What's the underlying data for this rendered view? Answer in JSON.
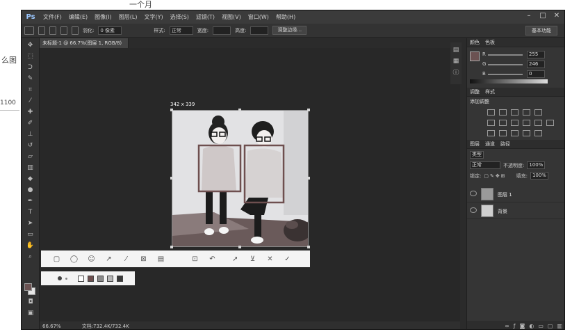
{
  "background": {
    "heading_fragment": "一个月",
    "side_text": "么图",
    "side_number": "1100"
  },
  "menubar": {
    "logo": "Ps",
    "items": [
      "文件(F)",
      "编辑(E)",
      "图像(I)",
      "图层(L)",
      "文字(Y)",
      "选择(S)",
      "滤镜(T)",
      "视图(V)",
      "窗口(W)",
      "帮助(H)"
    ],
    "controls": [
      "–",
      "□",
      "✕"
    ]
  },
  "options": {
    "feather_label": "羽化:",
    "feather_value": "0 像素",
    "style_label": "样式:",
    "style_value": "正常",
    "width_label": "宽度:",
    "height_label": "高度:",
    "refine_edge": "调整边缘...",
    "workspace": "基本功能"
  },
  "document": {
    "tab": "未标题-1 @ 66.7%(图层 1, RGB/8)",
    "zoom": "66.67%",
    "doc_info": "文档:732.4K/732.4K"
  },
  "capture": {
    "size_label": "342 x 339"
  },
  "snip_tools": {
    "buttons": [
      {
        "name": "rectangle-tool-icon",
        "glyph": "▢"
      },
      {
        "name": "ellipse-tool-icon",
        "glyph": "◯"
      },
      {
        "name": "emoji-tool-icon",
        "glyph": "☺"
      },
      {
        "name": "arrow-tool-icon",
        "glyph": "↗"
      },
      {
        "name": "pen-tool-icon",
        "glyph": "⁄"
      },
      {
        "name": "mosaic-tool-icon",
        "glyph": "⊠"
      },
      {
        "name": "text-tool-icon",
        "glyph": "▤"
      },
      {
        "name": "pin-tool-icon",
        "glyph": "⊡"
      },
      {
        "name": "undo-icon",
        "glyph": "↶"
      },
      {
        "name": "share-icon",
        "glyph": "➚"
      },
      {
        "name": "save-icon",
        "glyph": "⊻"
      },
      {
        "name": "close-icon",
        "glyph": "✕"
      },
      {
        "name": "confirm-icon",
        "glyph": "✓"
      }
    ],
    "palette": [
      "#ffffff",
      "#6e4f4f",
      "#8a8a8a",
      "#b8b8b8",
      "#3a3a3a"
    ]
  },
  "panels": {
    "color_tabs": [
      "颜色",
      "色板"
    ],
    "color_sliders": [
      {
        "label": "R",
        "value": "255"
      },
      {
        "label": "G",
        "value": "246"
      },
      {
        "label": "B",
        "value": "0"
      }
    ],
    "adjust_tabs": [
      "调整",
      "样式"
    ],
    "adjust_title": "添加调整",
    "layer_tabs": [
      "图层",
      "通道",
      "路径"
    ],
    "kind_label": "类型",
    "blend_mode": "正常",
    "opacity_label": "不透明度:",
    "opacity_value": "100%",
    "lock_label": "锁定:",
    "fill_label": "填充:",
    "fill_value": "100%",
    "layers": [
      {
        "name": "图层 1"
      },
      {
        "name": "背景"
      }
    ]
  },
  "colors": {
    "selection_border": "#6e4f4f",
    "foreground": "#6b5252",
    "background_swatch": "#e6e6e6"
  }
}
